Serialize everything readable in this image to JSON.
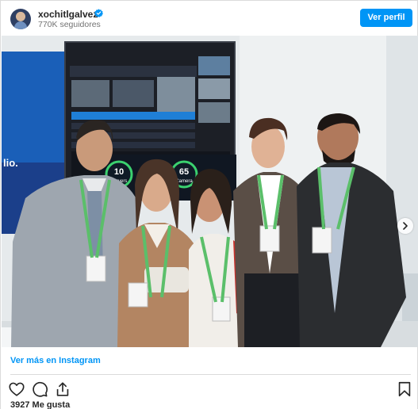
{
  "header": {
    "username": "xochitlgalvez",
    "followers": "770K seguidores",
    "follow_label": "Ver perfil",
    "verified_icon": "verified-badge-icon",
    "accent": "#0095f6"
  },
  "photo": {
    "screen_text": {
      "servers_value": "10",
      "servers_label": "Servers",
      "cameras_value": "65",
      "cameras_label": "Camera",
      "side_fragment": "lio."
    },
    "carousel_dots": 5,
    "active_dot": 0
  },
  "footer": {
    "view_more": "Ver más en Instagram",
    "likes": "3927 Me gusta",
    "icons": [
      "heart-icon",
      "comment-icon",
      "share-icon",
      "bookmark-icon"
    ]
  }
}
